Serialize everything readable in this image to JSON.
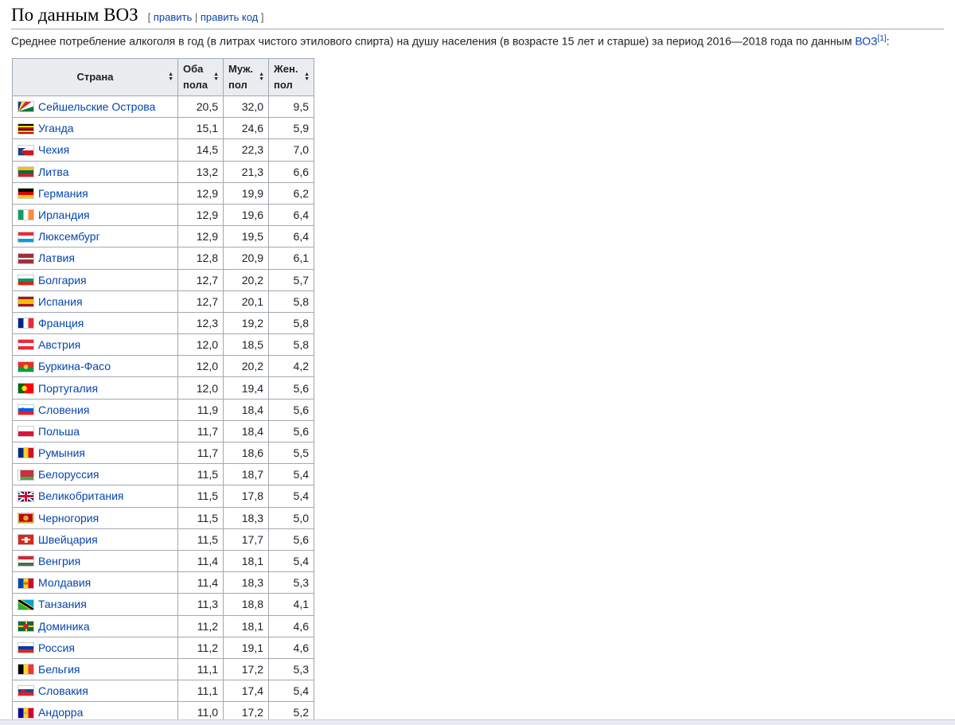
{
  "section": {
    "title": "По данным ВОЗ",
    "edit_open": "[ ",
    "edit_label": "править",
    "edit_sep": " | ",
    "edit_code_label": "править код",
    "edit_close": " ]"
  },
  "intro": {
    "text": "Среднее потребление алкоголя в год (в литрах чистого этилового спирта) на душу населения (в возрасте 15 лет и старше) за период 2016—2018 года по данным ",
    "link": "ВОЗ",
    "ref": "[1]",
    "tail": ":"
  },
  "table": {
    "headers": {
      "country": "Страна",
      "both_1": "Оба",
      "both_2": "пола",
      "male_1": "Муж.",
      "male_2": "пол",
      "female_1": "Жен.",
      "female_2": "пол"
    },
    "rows": [
      {
        "country": "Сейшельские Острова",
        "flag": "seychelles-flag-icon",
        "both": "20,5",
        "male": "32,0",
        "female": "9,5"
      },
      {
        "country": "Уганда",
        "flag": "uganda-flag-icon",
        "both": "15,1",
        "male": "24,6",
        "female": "5,9"
      },
      {
        "country": "Чехия",
        "flag": "czechia-flag-icon",
        "both": "14,5",
        "male": "22,3",
        "female": "7,0"
      },
      {
        "country": "Литва",
        "flag": "lithuania-flag-icon",
        "both": "13,2",
        "male": "21,3",
        "female": "6,6"
      },
      {
        "country": "Германия",
        "flag": "germany-flag-icon",
        "both": "12,9",
        "male": "19,9",
        "female": "6,2"
      },
      {
        "country": "Ирландия",
        "flag": "ireland-flag-icon",
        "both": "12,9",
        "male": "19,6",
        "female": "6,4"
      },
      {
        "country": "Люксембург",
        "flag": "luxembourg-flag-icon",
        "both": "12,9",
        "male": "19,5",
        "female": "6,4"
      },
      {
        "country": "Латвия",
        "flag": "latvia-flag-icon",
        "both": "12,8",
        "male": "20,9",
        "female": "6,1"
      },
      {
        "country": "Болгария",
        "flag": "bulgaria-flag-icon",
        "both": "12,7",
        "male": "20,2",
        "female": "5,7"
      },
      {
        "country": "Испания",
        "flag": "spain-flag-icon",
        "both": "12,7",
        "male": "20,1",
        "female": "5,8"
      },
      {
        "country": "Франция",
        "flag": "france-flag-icon",
        "both": "12,3",
        "male": "19,2",
        "female": "5,8"
      },
      {
        "country": "Австрия",
        "flag": "austria-flag-icon",
        "both": "12,0",
        "male": "18,5",
        "female": "5,8"
      },
      {
        "country": "Буркина-Фасо",
        "flag": "burkina-faso-flag-icon",
        "both": "12,0",
        "male": "20,2",
        "female": "4,2"
      },
      {
        "country": "Португалия",
        "flag": "portugal-flag-icon",
        "both": "12,0",
        "male": "19,4",
        "female": "5,6"
      },
      {
        "country": "Словения",
        "flag": "slovenia-flag-icon",
        "both": "11,9",
        "male": "18,4",
        "female": "5,6"
      },
      {
        "country": "Польша",
        "flag": "poland-flag-icon",
        "both": "11,7",
        "male": "18,4",
        "female": "5,6"
      },
      {
        "country": "Румыния",
        "flag": "romania-flag-icon",
        "both": "11,7",
        "male": "18,6",
        "female": "5,5"
      },
      {
        "country": "Белоруссия",
        "flag": "belarus-flag-icon",
        "both": "11,5",
        "male": "18,7",
        "female": "5,4"
      },
      {
        "country": "Великобритания",
        "flag": "uk-flag-icon",
        "both": "11,5",
        "male": "17,8",
        "female": "5,4"
      },
      {
        "country": "Черногория",
        "flag": "montenegro-flag-icon",
        "both": "11,5",
        "male": "18,3",
        "female": "5,0"
      },
      {
        "country": "Швейцария",
        "flag": "switzerland-flag-icon",
        "both": "11,5",
        "male": "17,7",
        "female": "5,6"
      },
      {
        "country": "Венгрия",
        "flag": "hungary-flag-icon",
        "both": "11,4",
        "male": "18,1",
        "female": "5,4"
      },
      {
        "country": "Молдавия",
        "flag": "moldova-flag-icon",
        "both": "11,4",
        "male": "18,3",
        "female": "5,3"
      },
      {
        "country": "Танзания",
        "flag": "tanzania-flag-icon",
        "both": "11,3",
        "male": "18,8",
        "female": "4,1"
      },
      {
        "country": "Доминика",
        "flag": "dominica-flag-icon",
        "both": "11,2",
        "male": "18,1",
        "female": "4,6"
      },
      {
        "country": "Россия",
        "flag": "russia-flag-icon",
        "both": "11,2",
        "male": "19,1",
        "female": "4,6"
      },
      {
        "country": "Бельгия",
        "flag": "belgium-flag-icon",
        "both": "11,1",
        "male": "17,2",
        "female": "5,3"
      },
      {
        "country": "Словакия",
        "flag": "slovakia-flag-icon",
        "both": "11,1",
        "male": "17,4",
        "female": "5,4"
      },
      {
        "country": "Андорра",
        "flag": "andorra-flag-icon",
        "both": "11,0",
        "male": "17,2",
        "female": "5,2"
      }
    ]
  }
}
